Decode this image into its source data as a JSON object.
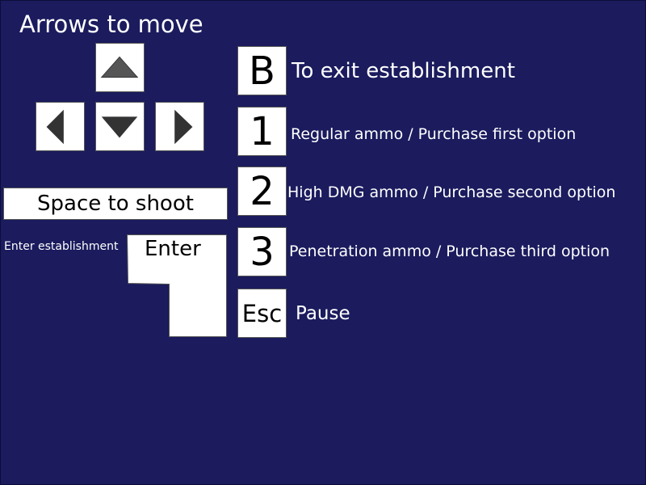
{
  "screen": {
    "background": "#1b1b5e",
    "key_color": "#ffffff",
    "arrow_color": "#555555"
  },
  "movement": {
    "title": "Arrows to move",
    "keys": [
      {
        "name": "up",
        "icon": "arrow-up-icon"
      },
      {
        "name": "left",
        "icon": "arrow-left-icon"
      },
      {
        "name": "down",
        "icon": "arrow-down-icon"
      },
      {
        "name": "right",
        "icon": "arrow-right-icon"
      }
    ]
  },
  "shoot": {
    "label": "Space to shoot"
  },
  "enter": {
    "key_label": "Enter",
    "description": "Enter establishment"
  },
  "bindings": [
    {
      "key": "B",
      "description": "To exit establishment"
    },
    {
      "key": "1",
      "description": "Regular ammo / Purchase first option"
    },
    {
      "key": "2",
      "description": "High DMG ammo / Purchase second option"
    },
    {
      "key": "3",
      "description": "Penetration ammo / Purchase third option"
    },
    {
      "key": "Esc",
      "description": "Pause"
    }
  ]
}
